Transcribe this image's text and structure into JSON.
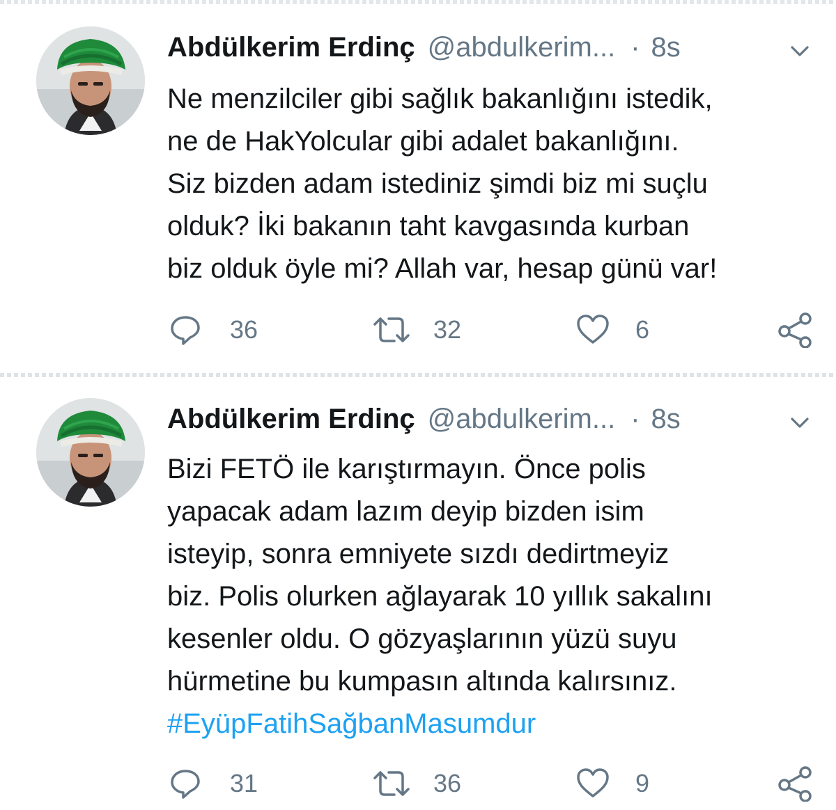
{
  "tweets": [
    {
      "name": "Abdülkerim Erdinç",
      "handle": "@abdulkerim...",
      "separator": "·",
      "time": "8s",
      "lines": [
        "Ne menzilciler gibi sağlık bakanlığını istedik,",
        "ne de HakYolcular gibi adalet bakanlığını.",
        "Siz bizden adam istediniz şimdi biz mi suçlu",
        "olduk? İki bakanın taht kavgasında kurban",
        "biz olduk öyle mi? Allah var, hesap günü var!"
      ],
      "hashtag": "",
      "replies": "36",
      "retweets": "32",
      "likes": "6"
    },
    {
      "name": "Abdülkerim Erdinç",
      "handle": "@abdulkerim...",
      "separator": "·",
      "time": "8s",
      "lines": [
        "Bizi FETÖ ile karıştırmayın. Önce polis",
        "yapacak adam lazım deyip bizden isim",
        "isteyip, sonra emniyete sızdı dedirtmeyiz",
        "biz. Polis olurken ağlayarak 10 yıllık sakalını",
        "kesenler oldu. O gözyaşlarının yüzü suyu",
        "hürmetine bu kumpasın altında kalırsınız."
      ],
      "hashtag": "#EyüpFatihSağbanMasumdur",
      "replies": "31",
      "retweets": "36",
      "likes": "9"
    }
  ],
  "icons": {
    "avatar": "avatar-green-turban",
    "menu": "chevron-down-icon",
    "reply": "reply-icon",
    "retweet": "retweet-icon",
    "like": "heart-icon",
    "share": "share-icon"
  },
  "colors": {
    "text": "#14171a",
    "secondary": "#657786",
    "link": "#1da1f2",
    "turban": "#1f8a3a"
  }
}
